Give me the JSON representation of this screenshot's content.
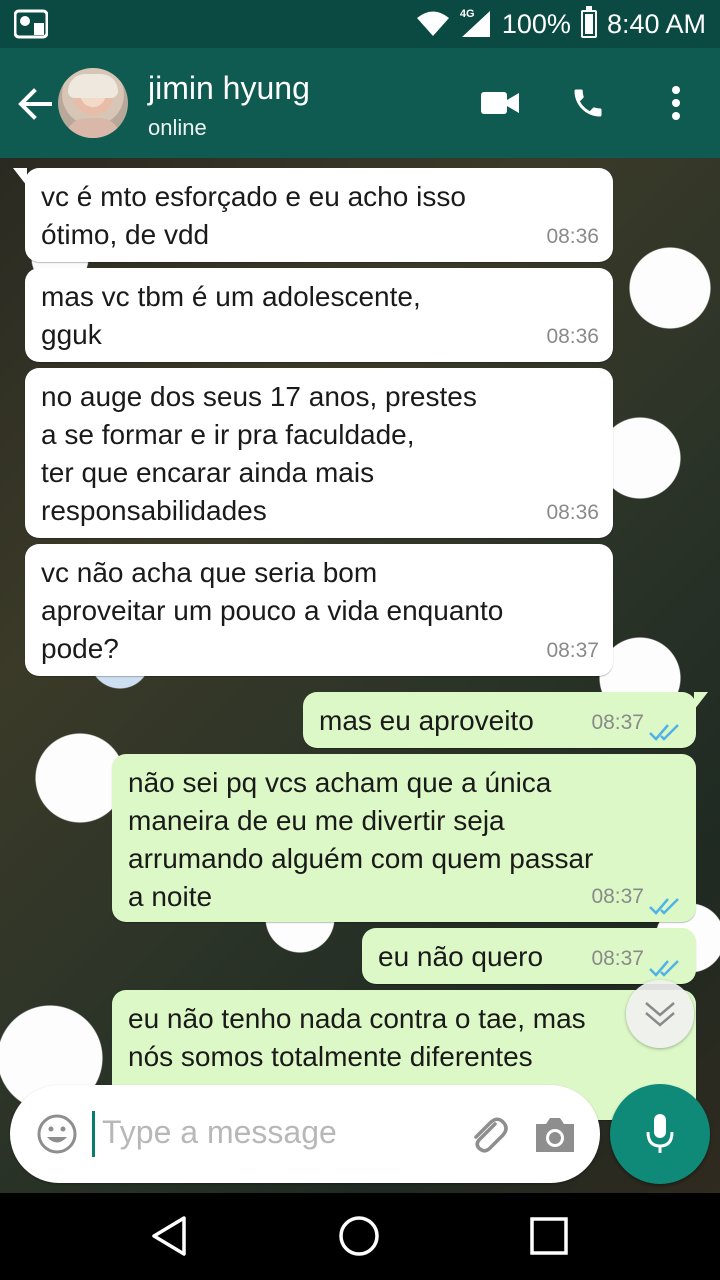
{
  "status_bar": {
    "network_type": "4G",
    "battery": "100%",
    "time": "8:40 AM"
  },
  "header": {
    "contact_name": "jimin hyung",
    "contact_status": "online"
  },
  "messages": [
    {
      "direction": "incoming",
      "text": "vc é mto esforçado e eu acho isso\nótimo, de vdd",
      "time": "08:36"
    },
    {
      "direction": "incoming",
      "text": "mas vc tbm é um adolescente,\ngguk",
      "time": "08:36"
    },
    {
      "direction": "incoming",
      "text": "no auge dos seus 17 anos, prestes\na se formar e ir pra faculdade,\nter que encarar ainda mais\nresponsabilidades",
      "time": "08:36"
    },
    {
      "direction": "incoming",
      "text": "vc não acha que seria bom\naproveitar um pouco a vida enquanto\npode?",
      "time": "08:37"
    },
    {
      "direction": "outgoing",
      "text": "mas eu aproveito",
      "time": "08:37"
    },
    {
      "direction": "outgoing",
      "text": "não sei pq vcs acham que a única\nmaneira de eu me divertir seja\narrumando alguém com quem passar\na noite",
      "time": "08:37"
    },
    {
      "direction": "outgoing",
      "text": "eu não quero",
      "time": "08:37"
    },
    {
      "direction": "outgoing",
      "text": "eu não tenho nada contra o tae, mas\nnós somos totalmente diferentes",
      "time": ""
    }
  ],
  "composer": {
    "placeholder": "Type a message"
  },
  "colors": {
    "header": "#0f5b51",
    "status_bar": "#0b4a42",
    "outgoing_bubble": "#dcf8c6",
    "incoming_bubble": "#ffffff",
    "accent": "#0f8a78",
    "read_ticks": "#4fb3e8"
  },
  "icons": [
    "back-arrow-icon",
    "video-call-icon",
    "phone-icon",
    "more-vert-icon",
    "emoji-icon",
    "attach-icon",
    "camera-icon",
    "mic-icon",
    "scroll-down-icon",
    "nav-back-icon",
    "nav-home-icon",
    "nav-recents-icon"
  ]
}
